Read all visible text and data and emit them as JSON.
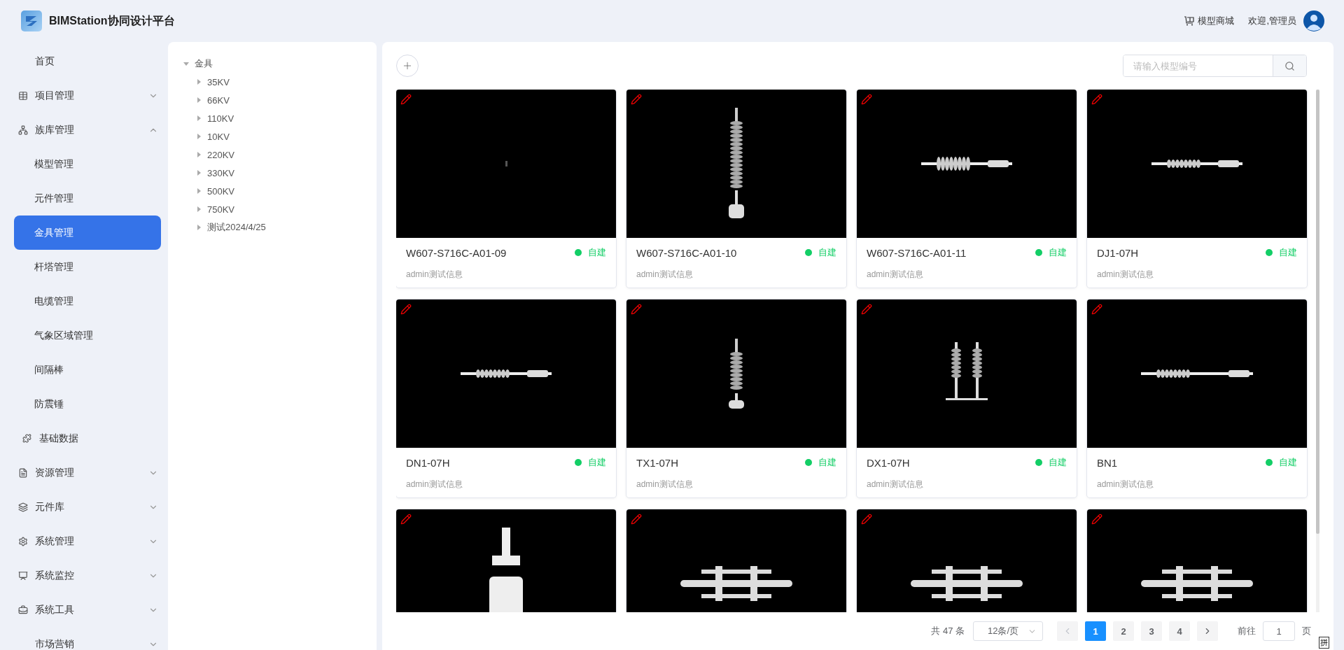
{
  "header": {
    "title": "BIMStation协同设计平台",
    "shop_link": "模型商城",
    "welcome": "欢迎,管理员"
  },
  "sidebar": {
    "items": [
      {
        "label": "首页",
        "kind": "link"
      },
      {
        "label": "项目管理",
        "kind": "group",
        "expanded": false
      },
      {
        "label": "族库管理",
        "kind": "group",
        "expanded": true,
        "children": [
          {
            "label": "模型管理",
            "kind": "plain",
            "selected": false
          },
          {
            "label": "元件管理",
            "kind": "plain",
            "selected": false
          },
          {
            "label": "金具管理",
            "kind": "plain",
            "selected": true
          },
          {
            "label": "杆塔管理",
            "kind": "plain",
            "selected": false
          },
          {
            "label": "电缆管理",
            "kind": "plain",
            "selected": false
          },
          {
            "label": "气象区域管理",
            "kind": "plain",
            "selected": false
          },
          {
            "label": "间隔棒",
            "kind": "plain",
            "selected": false
          },
          {
            "label": "防震锤",
            "kind": "plain",
            "selected": false
          },
          {
            "label": "基础数据",
            "kind": "icon",
            "selected": false
          }
        ]
      },
      {
        "label": "资源管理",
        "kind": "group",
        "expanded": false
      },
      {
        "label": "元件库",
        "kind": "group",
        "expanded": false
      },
      {
        "label": "系统管理",
        "kind": "group",
        "expanded": false
      },
      {
        "label": "系统监控",
        "kind": "group",
        "expanded": false
      },
      {
        "label": "系统工具",
        "kind": "group",
        "expanded": false
      },
      {
        "label": "市场营销",
        "kind": "group",
        "expanded": false
      }
    ]
  },
  "tree": {
    "label": "金具",
    "expanded": true,
    "children": [
      {
        "label": "35KV",
        "expanded": false
      },
      {
        "label": "66KV",
        "expanded": false
      },
      {
        "label": "110KV",
        "expanded": false
      },
      {
        "label": "10KV",
        "expanded": false
      },
      {
        "label": "220KV",
        "expanded": false
      },
      {
        "label": "330KV",
        "expanded": false
      },
      {
        "label": "500KV",
        "expanded": false
      },
      {
        "label": "750KV",
        "expanded": false
      },
      {
        "label": "测试2024/4/25",
        "expanded": false
      }
    ]
  },
  "search": {
    "placeholder": "请输入模型编号"
  },
  "cards": [
    {
      "name": "W607-S716C-A01-09",
      "status": "自建",
      "color": "#13ce66",
      "description": "admin测试信息",
      "editable": true
    },
    {
      "name": "W607-S716C-A01-10",
      "status": "自建",
      "color": "#13ce66",
      "description": "admin测试信息",
      "editable": true
    },
    {
      "name": "W607-S716C-A01-11",
      "status": "自建",
      "color": "#13ce66",
      "description": "admin测试信息",
      "editable": true
    },
    {
      "name": "DJ1-07H",
      "status": "自建",
      "color": "#13ce66",
      "description": "admin测试信息",
      "editable": true
    },
    {
      "name": "DN1-07H",
      "status": "自建",
      "color": "#13ce66",
      "description": "admin测试信息",
      "editable": true
    },
    {
      "name": "TX1-07H",
      "status": "自建",
      "color": "#13ce66",
      "description": "admin测试信息",
      "editable": true
    },
    {
      "name": "DX1-07H",
      "status": "自建",
      "color": "#13ce66",
      "description": "admin测试信息",
      "editable": true
    },
    {
      "name": "BN1",
      "status": "自建",
      "color": "#13ce66",
      "description": "admin测试信息",
      "editable": true
    },
    {
      "editable": true
    },
    {
      "editable": true
    },
    {
      "editable": true
    },
    {
      "editable": true
    }
  ],
  "pagination": {
    "total": "共 47 条",
    "page_size": "12条/页",
    "prev": {
      "disabled": true
    },
    "next": {
      "disabled": false
    },
    "pages": [
      {
        "label": "1",
        "selected": true
      },
      {
        "label": "2",
        "selected": false
      },
      {
        "label": "3",
        "selected": false
      },
      {
        "label": "4",
        "selected": false
      }
    ],
    "goto_label": "前往",
    "goto_value": "1",
    "goto_suffix": "页"
  },
  "ime_indicator": "拼"
}
